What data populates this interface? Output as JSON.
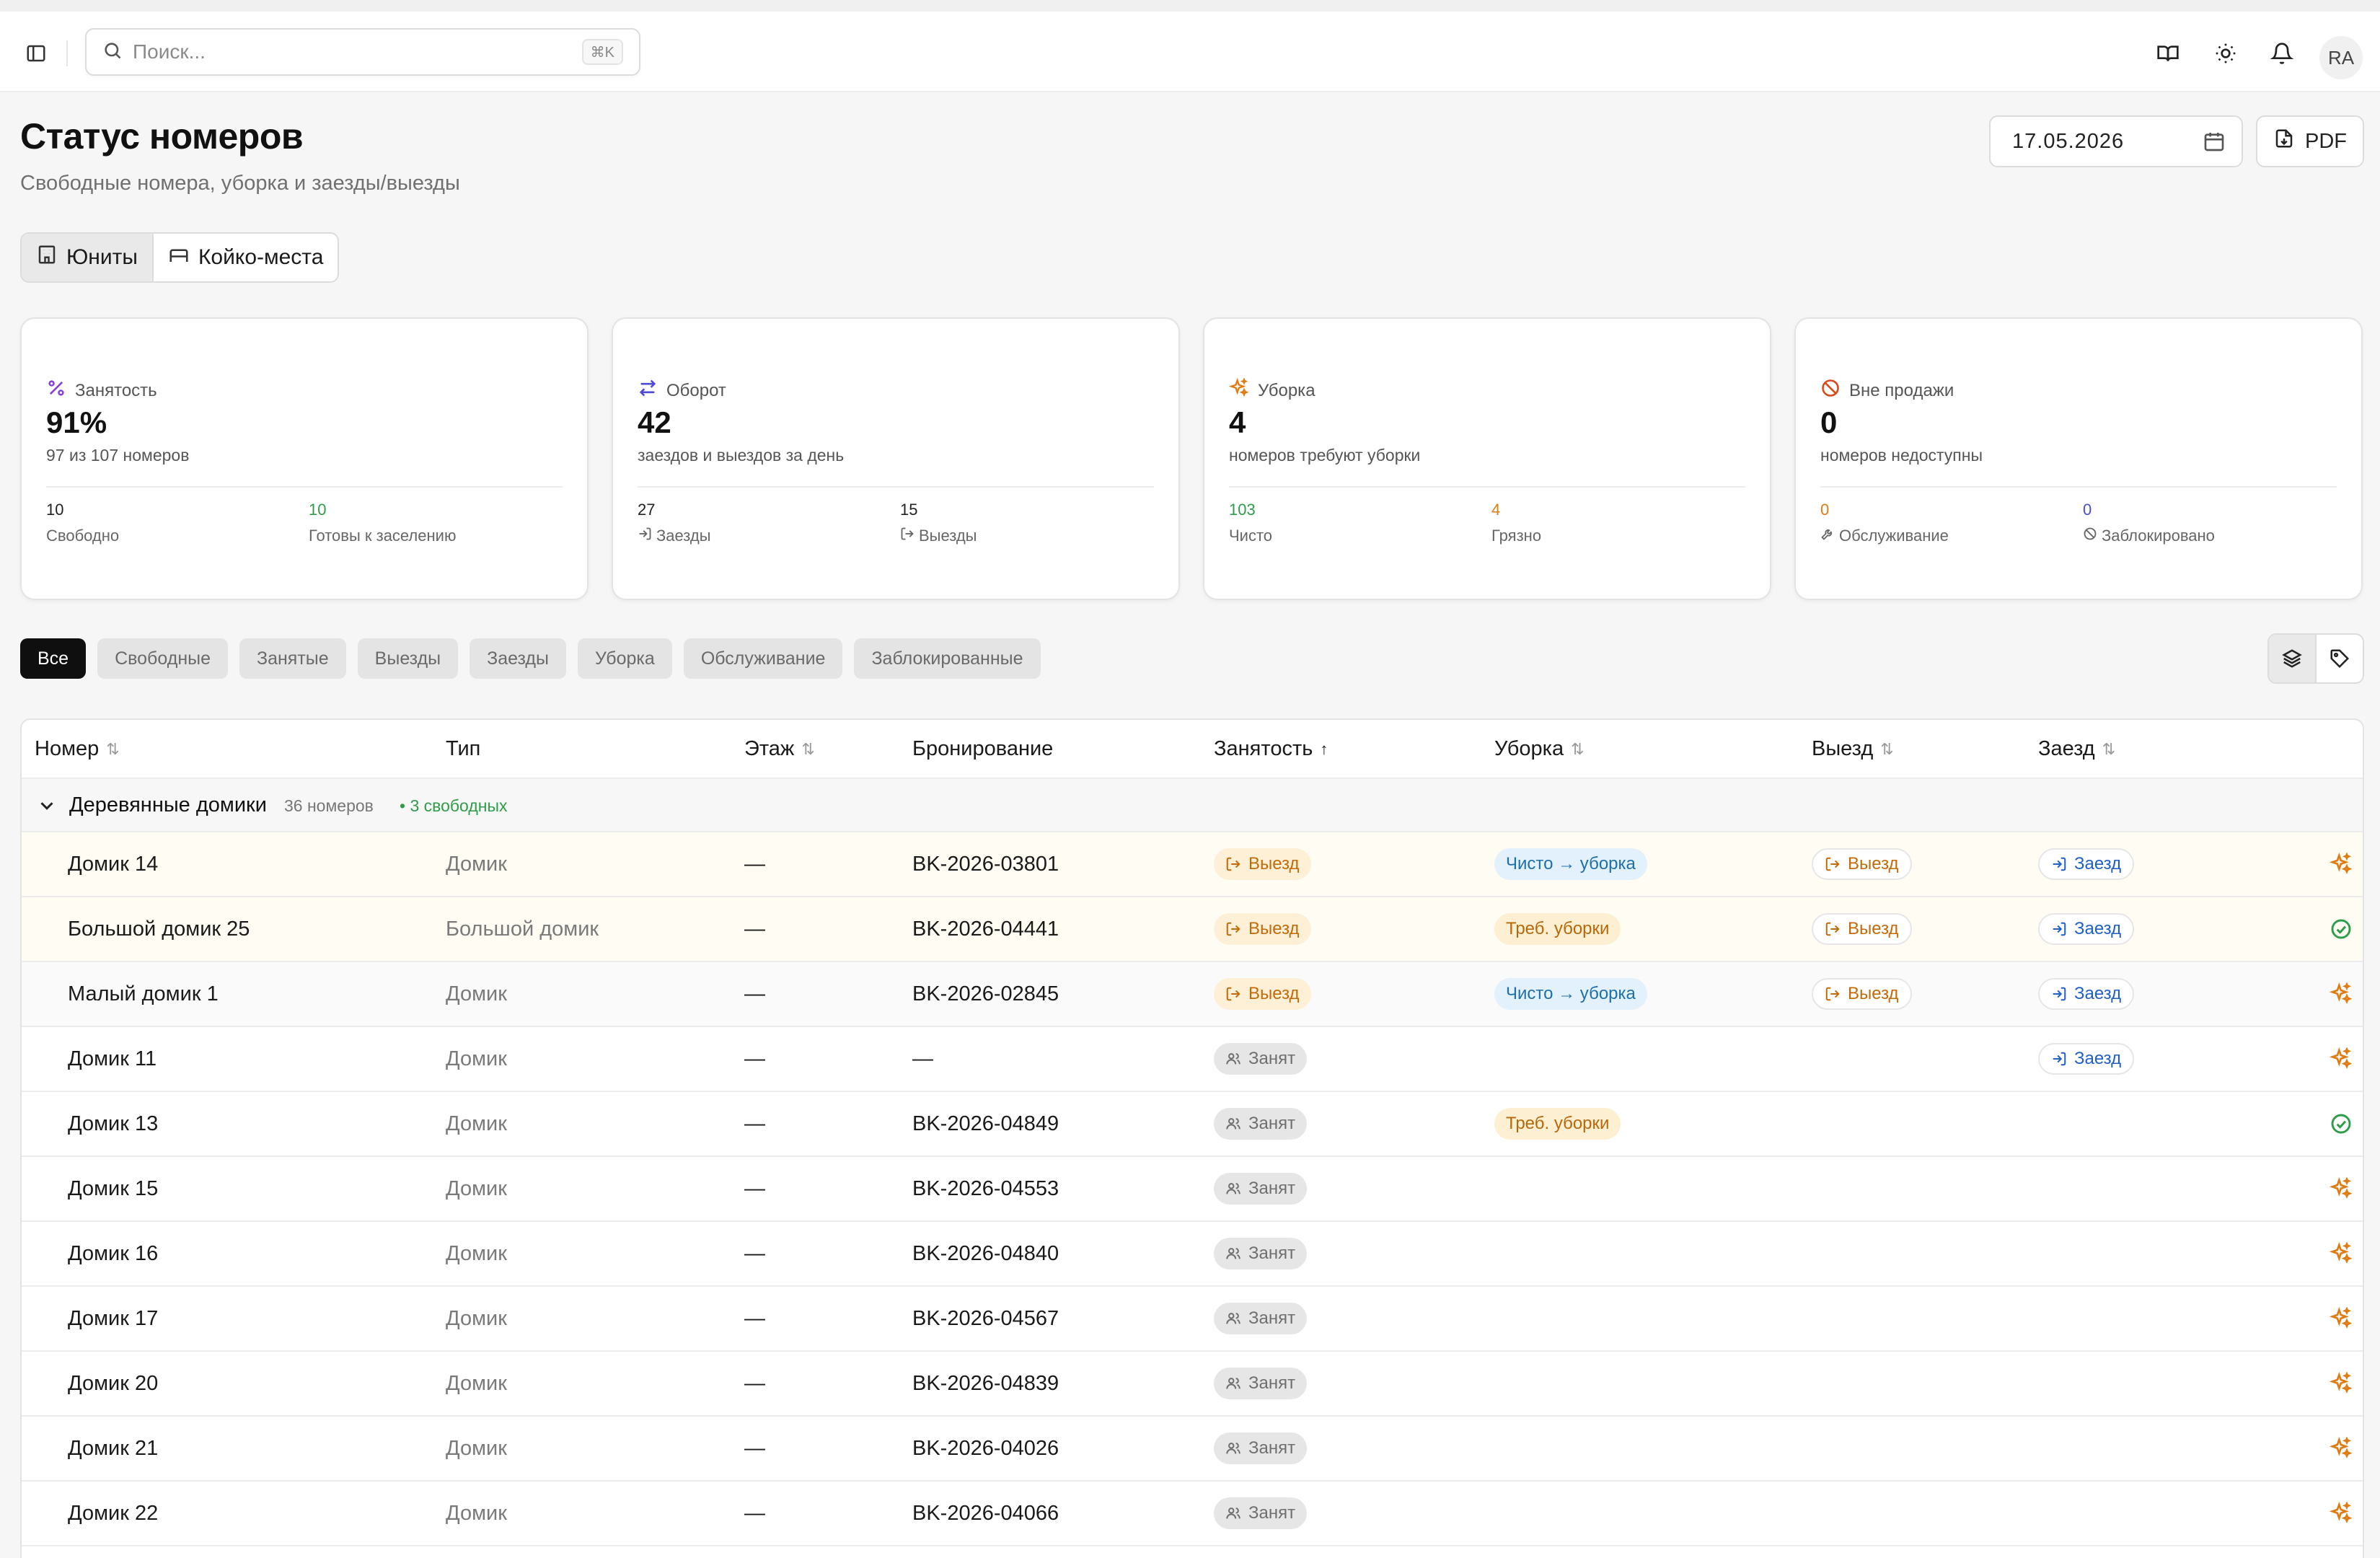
{
  "header": {
    "search_placeholder": "Поиск...",
    "search_shortcut": "⌘K",
    "avatar_initials": "RA"
  },
  "page": {
    "title": "Статус номеров",
    "subtitle": "Свободные номера, уборка и заезды/выезды",
    "date": "17.05.2026",
    "pdf_label": "PDF"
  },
  "mode_tabs": [
    {
      "label": "Юниты",
      "active": true
    },
    {
      "label": "Койко-места",
      "active": false
    }
  ],
  "stats": [
    {
      "label": "Занятость",
      "value": "91%",
      "desc": "97 из 107 номеров",
      "sub": [
        {
          "value": "10",
          "label": "Свободно",
          "color": "#222222"
        },
        {
          "value": "10",
          "label": "Готовы к заселению",
          "color": "#2e9d4a"
        }
      ]
    },
    {
      "label": "Оборот",
      "value": "42",
      "desc": "заездов и выездов за день",
      "sub": [
        {
          "value": "27",
          "label": "Заезды",
          "color": "#222222"
        },
        {
          "value": "15",
          "label": "Выезды",
          "color": "#222222"
        }
      ]
    },
    {
      "label": "Уборка",
      "value": "4",
      "desc": "номеров требуют уборки",
      "sub": [
        {
          "value": "103",
          "label": "Чисто",
          "color": "#2e9d4a"
        },
        {
          "value": "4",
          "label": "Грязно",
          "color": "#e07b12"
        }
      ]
    },
    {
      "label": "Вне продажи",
      "value": "0",
      "desc": "номеров недоступны",
      "sub": [
        {
          "value": "0",
          "label": "Обслуживание",
          "color": "#e07b12"
        },
        {
          "value": "0",
          "label": "Заблокировано",
          "color": "#4b4bd6"
        }
      ]
    }
  ],
  "filters": [
    "Все",
    "Свободные",
    "Занятые",
    "Выезды",
    "Заезды",
    "Уборка",
    "Обслуживание",
    "Заблокированные"
  ],
  "table": {
    "columns": [
      "Номер",
      "Тип",
      "Этаж",
      "Бронирование",
      "Занятость",
      "Уборка",
      "Выезд",
      "Заезд"
    ],
    "group": {
      "name": "Деревянные домики",
      "count": "36 номеров",
      "free": "• 3 свободных"
    },
    "rows": [
      {
        "name": "Домик 14",
        "type": "Домик",
        "floor": "—",
        "booking": "BK-2026-03801",
        "occupancy": "Выезд",
        "cleaning": "Чисто → уборка",
        "checkout": "Выезд",
        "checkin": "Заезд",
        "action": "sparkle"
      },
      {
        "name": "Большой домик 25",
        "type": "Большой домик",
        "floor": "—",
        "booking": "BK-2026-04441",
        "occupancy": "Выезд",
        "cleaning": "Треб. уборки",
        "checkout": "Выезд",
        "checkin": "Заезд",
        "action": "check"
      },
      {
        "name": "Малый домик 1",
        "type": "Домик",
        "floor": "—",
        "booking": "BK-2026-02845",
        "occupancy": "Выезд",
        "cleaning": "Чисто → уборка",
        "checkout": "Выезд",
        "checkin": "Заезд",
        "action": "sparkle"
      },
      {
        "name": "Домик 11",
        "type": "Домик",
        "floor": "—",
        "booking": "—",
        "occupancy": "Занят",
        "cleaning": "",
        "checkout": "",
        "checkin": "Заезд",
        "action": "sparkle"
      },
      {
        "name": "Домик 13",
        "type": "Домик",
        "floor": "—",
        "booking": "BK-2026-04849",
        "occupancy": "Занят",
        "cleaning": "Треб. уборки",
        "checkout": "",
        "checkin": "",
        "action": "check"
      },
      {
        "name": "Домик 15",
        "type": "Домик",
        "floor": "—",
        "booking": "BK-2026-04553",
        "occupancy": "Занят",
        "cleaning": "",
        "checkout": "",
        "checkin": "",
        "action": "sparkle"
      },
      {
        "name": "Домик 16",
        "type": "Домик",
        "floor": "—",
        "booking": "BK-2026-04840",
        "occupancy": "Занят",
        "cleaning": "",
        "checkout": "",
        "checkin": "",
        "action": "sparkle"
      },
      {
        "name": "Домик 17",
        "type": "Домик",
        "floor": "—",
        "booking": "BK-2026-04567",
        "occupancy": "Занят",
        "cleaning": "",
        "checkout": "",
        "checkin": "",
        "action": "sparkle"
      },
      {
        "name": "Домик 20",
        "type": "Домик",
        "floor": "—",
        "booking": "BK-2026-04839",
        "occupancy": "Занят",
        "cleaning": "",
        "checkout": "",
        "checkin": "",
        "action": "sparkle"
      },
      {
        "name": "Домик 21",
        "type": "Домик",
        "floor": "—",
        "booking": "BK-2026-04026",
        "occupancy": "Занят",
        "cleaning": "",
        "checkout": "",
        "checkin": "",
        "action": "sparkle"
      },
      {
        "name": "Домик 22",
        "type": "Домик",
        "floor": "—",
        "booking": "BK-2026-04066",
        "occupancy": "Занят",
        "cleaning": "",
        "checkout": "",
        "checkin": "",
        "action": "sparkle"
      }
    ]
  },
  "colors": {
    "accent_orange": "#e07b12",
    "accent_green": "#2e9d4a",
    "accent_purple": "#8a3fd6",
    "accent_blue": "#4b4bd6"
  }
}
